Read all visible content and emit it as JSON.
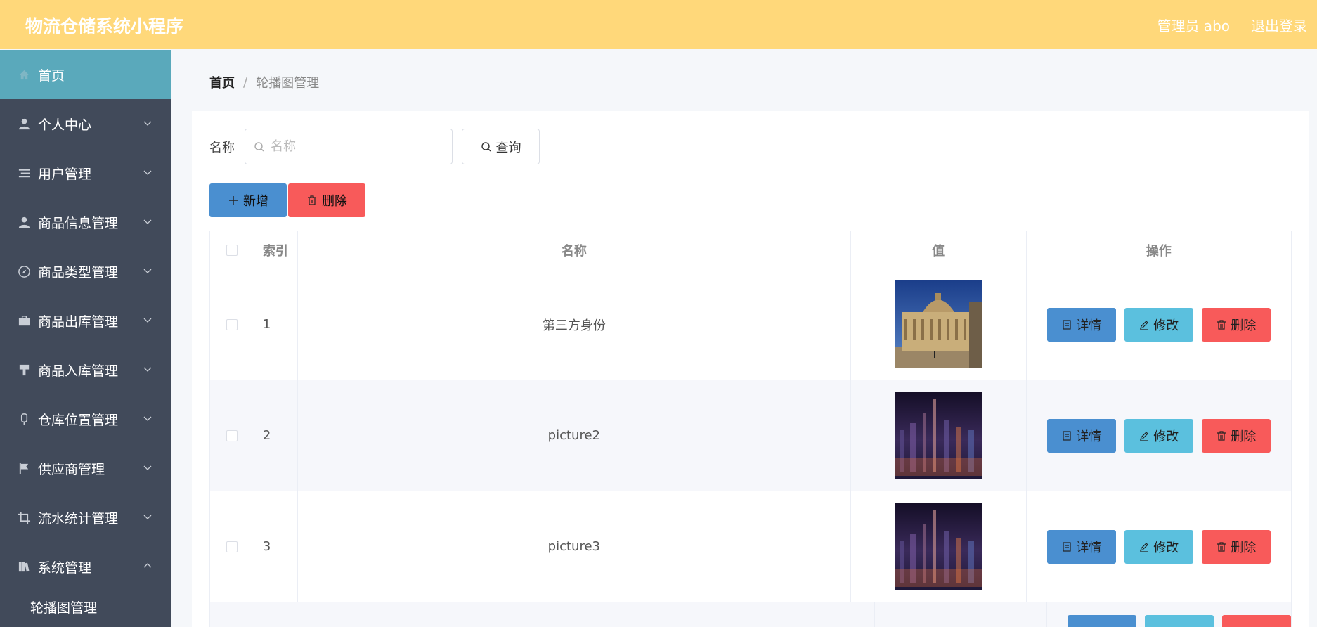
{
  "app": {
    "title": "物流仓储系统小程序"
  },
  "topbar": {
    "user": "管理员 abo",
    "logout": "退出登录"
  },
  "sidebar": {
    "items": [
      {
        "label": "首页",
        "icon": "home-icon",
        "active": true
      },
      {
        "label": "个人中心",
        "icon": "person-icon"
      },
      {
        "label": "用户管理",
        "icon": "list-icon"
      },
      {
        "label": "商品信息管理",
        "icon": "person-icon"
      },
      {
        "label": "商品类型管理",
        "icon": "compass-icon"
      },
      {
        "label": "商品出库管理",
        "icon": "briefcase-icon"
      },
      {
        "label": "商品入库管理",
        "icon": "paint-roller-icon"
      },
      {
        "label": "仓库位置管理",
        "icon": "microphone-icon"
      },
      {
        "label": "供应商管理",
        "icon": "flag-icon"
      },
      {
        "label": "流水统计管理",
        "icon": "crop-icon"
      },
      {
        "label": "系统管理",
        "icon": "library-icon",
        "expanded": true
      }
    ],
    "sub_items": [
      {
        "label": "轮播图管理"
      }
    ]
  },
  "breadcrumb": {
    "home": "首页",
    "separator": "/",
    "current": "轮播图管理"
  },
  "search": {
    "label": "名称",
    "placeholder": "名称",
    "value": "",
    "button": "查询"
  },
  "actions": {
    "add": "新增",
    "delete": "删除"
  },
  "table": {
    "headers": {
      "index": "索引",
      "name": "名称",
      "value": "值",
      "ops": "操作"
    },
    "rows": [
      {
        "index": "1",
        "name": "第三方身份",
        "image": "cathedral-photo"
      },
      {
        "index": "2",
        "name": "picture2",
        "image": "city-lights-photo"
      },
      {
        "index": "3",
        "name": "picture3",
        "image": "city-lights-photo"
      }
    ],
    "row_actions": {
      "detail": "详情",
      "edit": "修改",
      "delete": "删除"
    }
  },
  "colors": {
    "topbar": "#ffd87a",
    "sidebar": "#414a5a",
    "sidebar_active": "#5aa9bb",
    "primary": "#4a8fd0",
    "info": "#5bc0de",
    "danger": "#f85a5a"
  }
}
